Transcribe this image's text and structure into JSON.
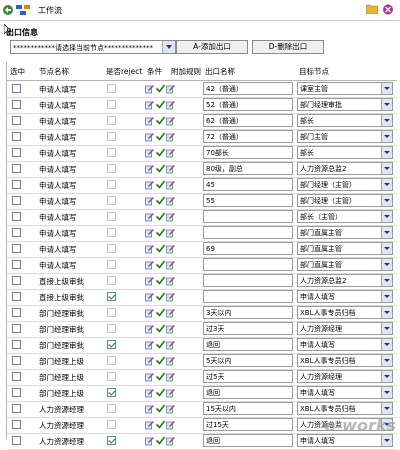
{
  "app": {
    "title": "工作流"
  },
  "section_title": "出口信息",
  "toolbar": {
    "node_select": "************请选择当前节点**************",
    "add_label": "A-添加出口",
    "delete_label": "D-删除出口"
  },
  "columns": {
    "select": "选中",
    "node": "节点名称",
    "reject": "是否reject",
    "condition": "条件",
    "rule": "附加规则",
    "out_name": "出口名称",
    "target": "目标节点"
  },
  "rows": [
    {
      "node": "申请人填写",
      "rej": false,
      "out": "42（普通）",
      "target": "课室主管"
    },
    {
      "node": "申请人填写",
      "rej": false,
      "out": "52（普通）",
      "target": "部门经理审批"
    },
    {
      "node": "申请人填写",
      "rej": false,
      "out": "62（普通）",
      "target": "部长"
    },
    {
      "node": "申请人填写",
      "rej": false,
      "out": "72（普通）",
      "target": "部门主管"
    },
    {
      "node": "申请人填写",
      "rej": false,
      "out": "70部长",
      "target": "部长"
    },
    {
      "node": "申请人填写",
      "rej": false,
      "out": "80级，副总",
      "target": "人力资源总监2"
    },
    {
      "node": "申请人填写",
      "rej": false,
      "out": "45",
      "target": "部门经理（主管）"
    },
    {
      "node": "申请人填写",
      "rej": false,
      "out": "55",
      "target": "部门经理（主管）"
    },
    {
      "node": "申请人填写",
      "rej": false,
      "out": "",
      "target": "部长（主管）"
    },
    {
      "node": "申请人填写",
      "rej": false,
      "out": "",
      "target": "部门直属主管"
    },
    {
      "node": "申请人填写",
      "rej": false,
      "out": "69",
      "target": "部门直属主管"
    },
    {
      "node": "申请人填写",
      "rej": false,
      "out": "",
      "target": "部门直属主管"
    },
    {
      "node": "直接上级审批",
      "rej": false,
      "out": "",
      "target": "人力资源总监2"
    },
    {
      "node": "直接上级审批",
      "rej": true,
      "out": "",
      "target": "申请人填写"
    },
    {
      "node": "部门经理审批",
      "rej": false,
      "out": "3天以内",
      "target": "XBL人事专员归档"
    },
    {
      "node": "部门经理审批",
      "rej": false,
      "out": "过3天",
      "target": "人力资源经理"
    },
    {
      "node": "部门经理审批",
      "rej": true,
      "out": "退回",
      "target": "申请人填写"
    },
    {
      "node": "部门经理上级",
      "rej": false,
      "out": "5天以内",
      "target": "XBL人事专员归档"
    },
    {
      "node": "部门经理上级",
      "rej": false,
      "out": "过5天",
      "target": "人力资源经理"
    },
    {
      "node": "部门经理上级",
      "rej": true,
      "out": "退回",
      "target": "申请人填写"
    },
    {
      "node": "人力资源经理",
      "rej": false,
      "out": "15天以内",
      "target": "XBL人事专员归档"
    },
    {
      "node": "人力资源经理",
      "rej": false,
      "out": "过15天",
      "target": "人力资源总监"
    },
    {
      "node": "人力资源经理",
      "rej": true,
      "out": "退回",
      "target": "申请人填写"
    }
  ],
  "watermark": "e-works",
  "colors": {
    "check": "#1a7a1a",
    "header_rule": "#b5b5b5",
    "arrow": "#223a8a"
  },
  "icons": [
    "workflow-logo-icon",
    "folder-icon",
    "close-icon",
    "condition-edit-icon",
    "check-icon",
    "rule-edit-icon",
    "dropdown-arrow-icon"
  ]
}
